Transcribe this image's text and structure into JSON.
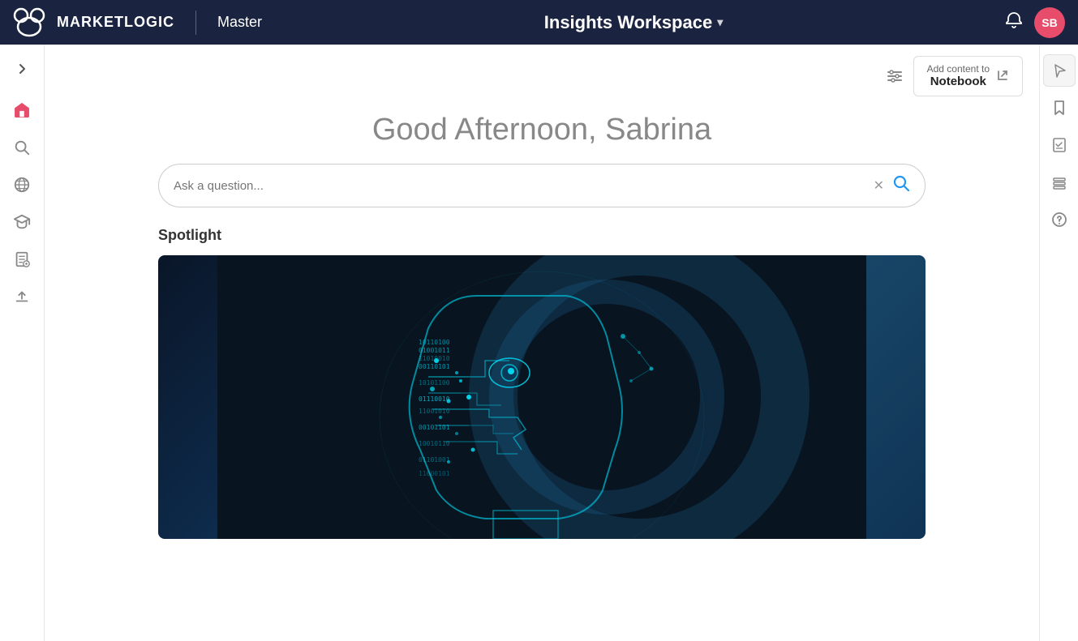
{
  "app": {
    "logo_text": "MARKETLOGIC",
    "nav_divider": "|",
    "master_label": "Master",
    "workspace_label": "Insights Workspace",
    "workspace_chevron": "▾",
    "avatar_initials": "SB"
  },
  "toolbar": {
    "add_notebook_label_top": "Add content to",
    "add_notebook_label_bottom": "Notebook"
  },
  "main": {
    "greeting": "Good Afternoon, Sabrina",
    "search_placeholder": "Ask a question...",
    "spotlight_label": "Spotlight"
  },
  "sidebar_left": {
    "items": [
      {
        "name": "expand",
        "icon": "chevron-right"
      },
      {
        "name": "home",
        "icon": "home",
        "active": true
      },
      {
        "name": "search",
        "icon": "search"
      },
      {
        "name": "globe",
        "icon": "globe"
      },
      {
        "name": "graduation",
        "icon": "graduation"
      },
      {
        "name": "clipboard",
        "icon": "clipboard"
      },
      {
        "name": "upload",
        "icon": "upload"
      }
    ]
  },
  "sidebar_right": {
    "items": [
      {
        "name": "cursor",
        "icon": "cursor"
      },
      {
        "name": "bookmark",
        "icon": "bookmark"
      },
      {
        "name": "checklist",
        "icon": "checklist"
      },
      {
        "name": "stack",
        "icon": "stack"
      },
      {
        "name": "help",
        "icon": "help"
      }
    ]
  }
}
